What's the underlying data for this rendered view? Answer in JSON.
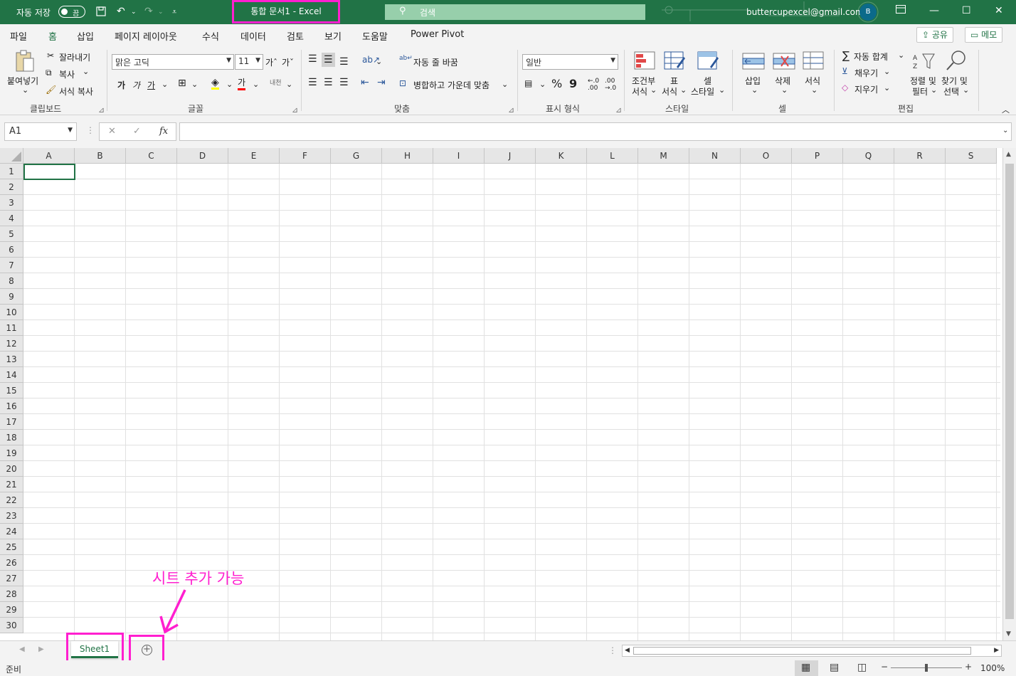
{
  "titlebar": {
    "autosave_label": "자동 저장",
    "autosave_state": "끔",
    "doc_title": "통합 문서1  -  Excel",
    "search_placeholder": "검색",
    "email": "buttercupexcel@gmail.com",
    "avatar_letter": "B"
  },
  "menu": {
    "items": [
      "파일",
      "홈",
      "삽입",
      "페이지 레이아웃",
      "수식",
      "데이터",
      "검토",
      "보기",
      "도움말",
      "Power Pivot"
    ],
    "share_label": "공유",
    "memo_label": "메모"
  },
  "ribbon": {
    "clipboard": {
      "paste": "붙여넣기",
      "cut": "잘라내기",
      "copy": "복사",
      "format_painter": "서식 복사",
      "group_label": "클립보드"
    },
    "font": {
      "font_name": "맑은 고딕",
      "font_size": "11",
      "bold": "가",
      "italic": "가",
      "underline": "가",
      "group_label": "글꼴"
    },
    "alignment": {
      "wrap_text": "자동 줄 바꿈",
      "merge_center": "병합하고 가운데 맞춤",
      "group_label": "맞춤"
    },
    "number": {
      "format": "일반",
      "percent": "%",
      "comma": "9",
      "group_label": "표시 형식"
    },
    "styles": {
      "conditional_line1": "조건부",
      "conditional_line2": "서식",
      "table_line1": "표",
      "table_line2": "서식",
      "cell_line1": "셀",
      "cell_line2": "스타일",
      "group_label": "스타일"
    },
    "cells": {
      "insert": "삽입",
      "delete": "삭제",
      "format": "서식",
      "group_label": "셀"
    },
    "editing": {
      "autosum": "자동 합계",
      "fill": "채우기",
      "clear": "지우기",
      "sort_line1": "정렬 및",
      "sort_line2": "필터",
      "find_line1": "찾기 및",
      "find_line2": "선택",
      "group_label": "편집"
    }
  },
  "formula_bar": {
    "name_box": "A1",
    "fx": "fx",
    "formula": ""
  },
  "columns": [
    "A",
    "B",
    "C",
    "D",
    "E",
    "F",
    "G",
    "H",
    "I",
    "J",
    "K",
    "L",
    "M",
    "N",
    "O",
    "P",
    "Q",
    "R",
    "S"
  ],
  "rows": [
    "1",
    "2",
    "3",
    "4",
    "5",
    "6",
    "7",
    "8",
    "9",
    "10",
    "11",
    "12",
    "13",
    "14",
    "15",
    "16",
    "17",
    "18",
    "19",
    "20",
    "21",
    "22",
    "23",
    "24",
    "25",
    "26",
    "27",
    "28",
    "29",
    "30"
  ],
  "annotation": "시트 추가 가능",
  "sheets": {
    "tabs": [
      "Sheet1"
    ],
    "add_symbol": "+"
  },
  "status": {
    "ready": "준비",
    "zoom": "100%"
  },
  "colors": {
    "excel_green": "#217346",
    "highlight": "#ff1fcf"
  }
}
